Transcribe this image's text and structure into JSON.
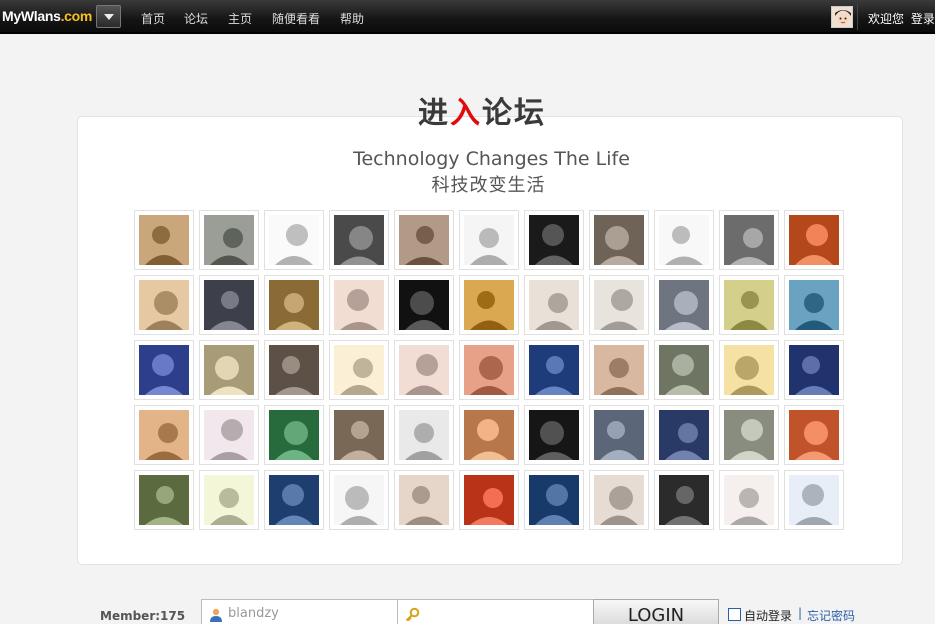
{
  "site": {
    "logo_main": "MyWlans",
    "logo_suffix": ".com"
  },
  "nav": {
    "items": [
      {
        "label": "首页"
      },
      {
        "label": "论坛"
      },
      {
        "label": "主页"
      },
      {
        "label": "随便看看"
      },
      {
        "label": "帮助"
      }
    ]
  },
  "user": {
    "welcome": "欢迎您",
    "login_link": "登录"
  },
  "page": {
    "title_part1": "进",
    "title_part2": "入",
    "title_part3": "论坛",
    "tagline_en": "Technology Changes The Life",
    "tagline_cn": "科技改变生活"
  },
  "avatars": {
    "count": 55,
    "palette": [
      "#c9a77b",
      "#9a9e97",
      "#fafafa",
      "#4a4a4a",
      "#b39a88",
      "#f5f5f5",
      "#1a1a1a",
      "#6f6357",
      "#f8f8f8",
      "#6c6c6c",
      "#b4481b",
      "#e6c9a2",
      "#3d3f4a",
      "#8a6a35",
      "#f2ddd3",
      "#111111",
      "#d9a850",
      "#e9e0d8",
      "#e8e4dd",
      "#6f7580",
      "#d4cf8a",
      "#6aa2c1",
      "#2d3f8b",
      "#a79b78",
      "#5d5046",
      "#fbefd5",
      "#f1ddd4",
      "#e8a189",
      "#1e3c7a",
      "#d8b8a0",
      "#6e7563",
      "#f5e1a4",
      "#21336d",
      "#e4b489",
      "#f1e7ec",
      "#276b3c",
      "#7a6856",
      "#e9e9e9",
      "#b8774a",
      "#161616",
      "#5b6678",
      "#2a3a66",
      "#888d80",
      "#c0532a",
      "#5b6b3f",
      "#f3f6d8",
      "#1d3e6e",
      "#f6f6f6",
      "#e5d6c9",
      "#b83318",
      "#173a6a",
      "#e7dcd3",
      "#2b2b2b",
      "#f5f0ee",
      "#e7eef8"
    ]
  },
  "login": {
    "member_label": "Member:175",
    "username_value": "blandzy",
    "password_value": "",
    "login_button": "LOGIN",
    "auto_login": "自动登录",
    "divider": "|",
    "forgot": "忘记密码"
  }
}
